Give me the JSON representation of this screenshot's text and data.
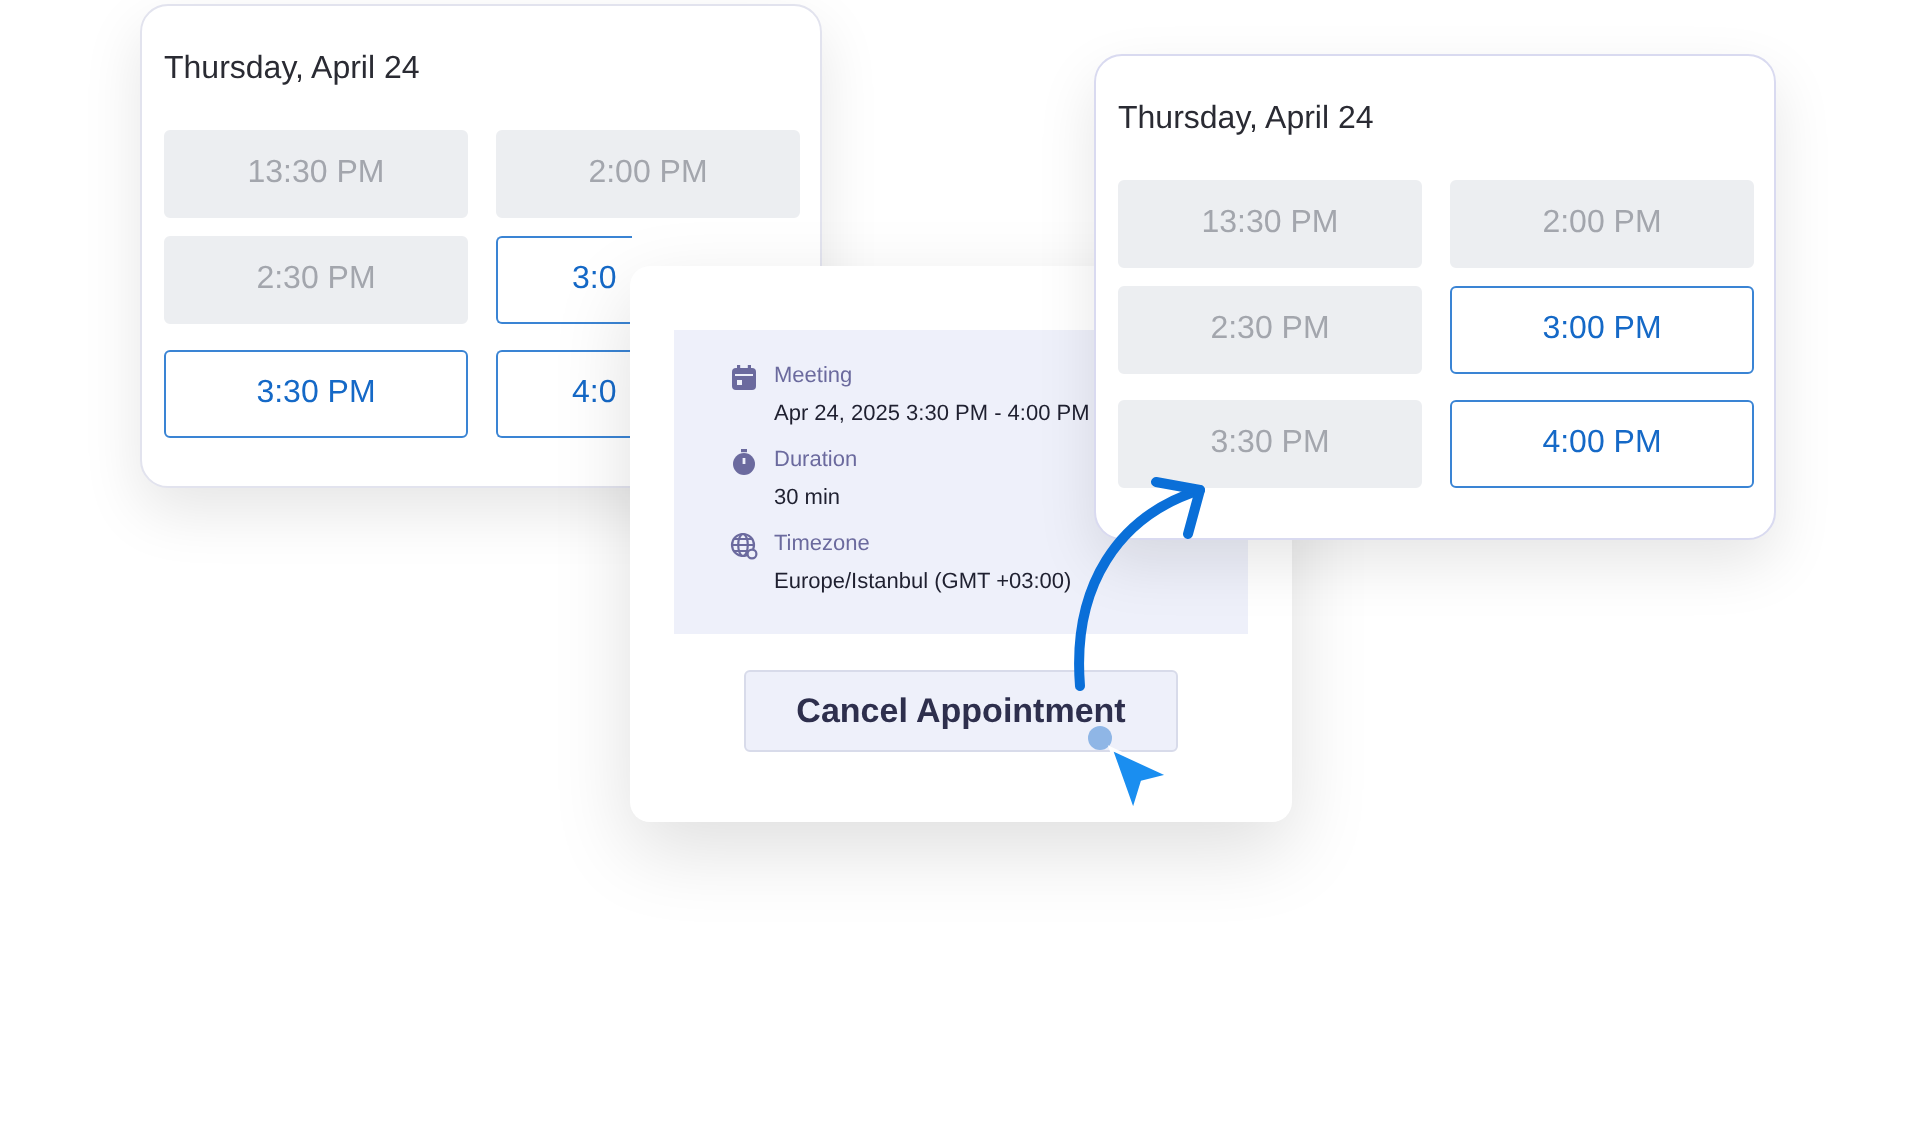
{
  "booking_before": {
    "date": "Thursday, April 24",
    "slots": [
      {
        "time": "13:30 PM",
        "available": false
      },
      {
        "time": "2:00 PM",
        "available": false
      },
      {
        "time": "2:30 PM",
        "available": false
      },
      {
        "time": "3:0",
        "available": true
      },
      {
        "time": "3:30 PM",
        "available": true
      },
      {
        "time": "4:0",
        "available": true
      }
    ]
  },
  "appointment": {
    "details": [
      {
        "kind": "calendar",
        "label": "Meeting",
        "value": "Apr 24, 2025 3:30 PM - 4:00 PM"
      },
      {
        "kind": "timer",
        "label": "Duration",
        "value": "30 min"
      },
      {
        "kind": "globe",
        "label": "Timezone",
        "value": "Europe/Istanbul (GMT +03:00)"
      }
    ],
    "cancel_button": "Cancel Appointment"
  },
  "booking_after": {
    "date": "Thursday, April 24",
    "slots": [
      {
        "time": "13:30 PM",
        "available": false
      },
      {
        "time": "2:00 PM",
        "available": false
      },
      {
        "time": "2:30 PM",
        "available": false
      },
      {
        "time": "3:00 PM",
        "available": true
      },
      {
        "time": "3:30 PM",
        "available": false
      },
      {
        "time": "4:00 PM",
        "available": true
      }
    ]
  }
}
